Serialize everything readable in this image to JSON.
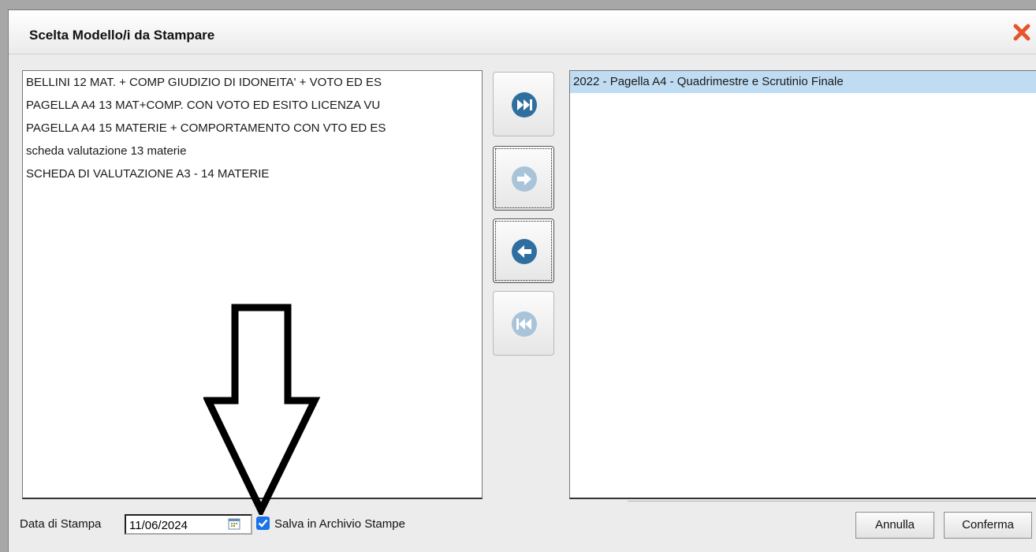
{
  "dialog": {
    "title": "Scelta Modello/i da Stampare",
    "close_icon": "close-x-icon"
  },
  "available_models": [
    "BELLINI 12 MAT. + COMP GIUDIZIO DI IDONEITA' + VOTO ED ES",
    "PAGELLA A4 13 MAT+COMP. CON VOTO ED ESITO LICENZA VU",
    "PAGELLA A4 15 MATERIE + COMPORTAMENTO CON VTO ED ES",
    "scheda valutazione 13 materie",
    "SCHEDA DI VALUTAZIONE A3 - 14 MATERIE"
  ],
  "selected_models": [
    "2022 - Pagella A4 - Quadrimestre e Scrutinio Finale"
  ],
  "move_buttons": [
    {
      "icon": "move-all-right-icon",
      "enabled": true
    },
    {
      "icon": "move-right-icon",
      "enabled": false
    },
    {
      "icon": "move-left-icon",
      "enabled": true
    },
    {
      "icon": "move-all-left-icon",
      "enabled": false
    }
  ],
  "footer": {
    "date_label": "Data di Stampa",
    "date_value": "11/06/2024",
    "calendar_icon": "calendar-icon",
    "save_checkbox_checked": true,
    "save_label": "Salva in Archivio Stampe",
    "cancel_label": "Annulla",
    "confirm_label": "Conferma"
  },
  "colors": {
    "accent_blue": "#2f6fa0",
    "disabled_blue": "#a9c4d9",
    "selection": "#bfdcf3",
    "close_red": "#e8542b"
  }
}
